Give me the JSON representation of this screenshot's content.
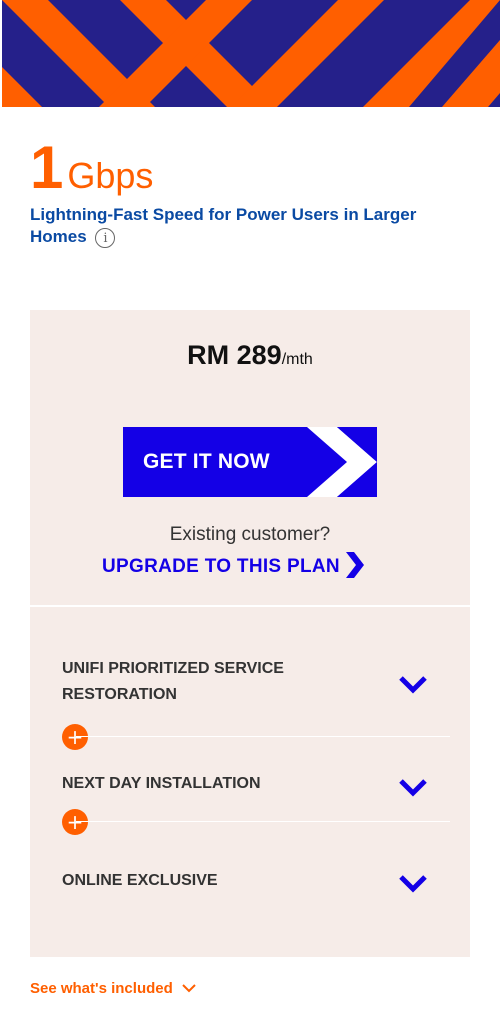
{
  "colors": {
    "brand_orange": "#ff5f00",
    "brand_blue": "#1400e6",
    "banner_navy": "#25208a",
    "link_blue": "#0a4aa3",
    "panel_bg": "#f6ece8"
  },
  "plan": {
    "speed_value": "1",
    "speed_unit": "Gbps",
    "tagline": "Lightning-Fast Speed for Power Users in Larger Homes",
    "info_icon": "info-icon"
  },
  "pricing": {
    "currency_amount": "RM 289",
    "period": "/mth",
    "cta_label": "GET IT NOW",
    "existing_text": "Existing customer?",
    "upgrade_label": "UPGRADE TO THIS PLAN"
  },
  "features": [
    {
      "title": "UNIFI PRIORITIZED SERVICE RESTORATION",
      "icon": "chevron-down-icon"
    },
    {
      "title": "NEXT DAY INSTALLATION",
      "icon": "chevron-down-icon"
    },
    {
      "title": "ONLINE EXCLUSIVE",
      "icon": "chevron-down-icon"
    }
  ],
  "connector_icons": [
    "plus-icon",
    "plus-icon"
  ],
  "plus_symbol": "+",
  "footer": {
    "see_more_label": "See what's included",
    "icon": "chevron-down-icon"
  }
}
